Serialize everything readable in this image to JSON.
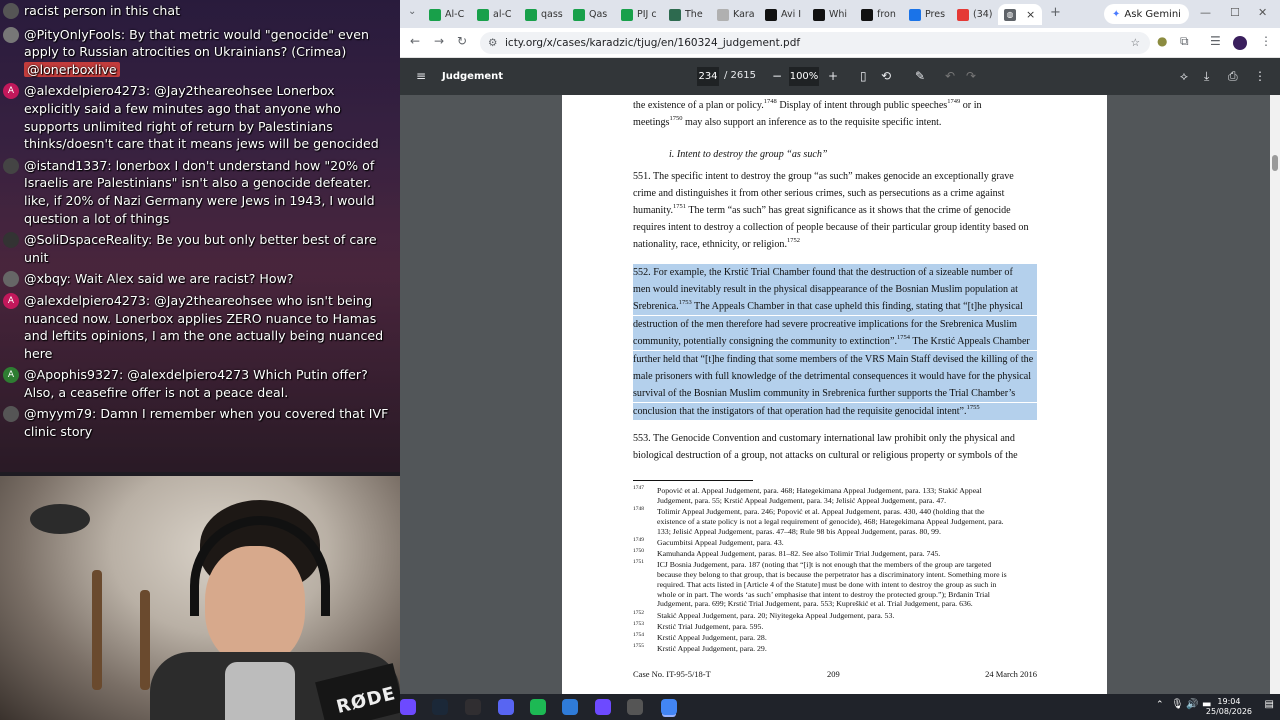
{
  "chat": {
    "messages": [
      {
        "user": "",
        "text": "racist person in this chat",
        "avatar": "",
        "avatar_color": "#555"
      },
      {
        "user": "@PityOnlyFools:",
        "text": " By that metric would \"genocide\" even apply to Russian atrocities on Ukrainians? (Crimea) ",
        "mention": "@lonerboxlive",
        "avatar": "",
        "avatar_color": "#777"
      },
      {
        "user": "@alexdelpiero4273:",
        "text": " @Jay2theareohsee Lonerbox explicitly said a few minutes ago that anyone who supports unlimited right of return by Palestinians thinks/doesn't care that it means jews will be genocided",
        "avatar": "A",
        "avatar_color": "#c2185b"
      },
      {
        "user": "@istand1337:",
        "text": " lonerbox I don't understand how \"20% of Israelis are Palestinians\" isn't also a genocide defeater. like, if 20% of Nazi Germany were Jews in 1943, I would question a lot of things",
        "avatar": "",
        "avatar_color": "#444"
      },
      {
        "user": "@SoliDspaceReality:",
        "text": " Be you but only better best of care unit",
        "avatar": "",
        "avatar_color": "#333"
      },
      {
        "user": "@xbqy:",
        "text": " Wait Alex said we are racist? How?",
        "avatar": "",
        "avatar_color": "#666"
      },
      {
        "user": "@alexdelpiero4273:",
        "text": " @Jay2theareohsee who isn't being nuanced now. Lonerbox applies ZERO nuance to Hamas and leftits opinions, I am the one actually being nuanced here",
        "avatar": "A",
        "avatar_color": "#c2185b"
      },
      {
        "user": "@Apophis9327:",
        "text": " @alexdelpiero4273 Which Putin offer? Also, a ceasefire offer is not a peace deal.",
        "avatar": "A",
        "avatar_color": "#2e7d32"
      },
      {
        "user": "@myym79:",
        "text": " Damn I remember when you covered that IVF clinic story",
        "avatar": "",
        "avatar_color": "#555"
      }
    ],
    "mic_brand": "RØDE"
  },
  "browser": {
    "tabs": [
      {
        "label": "Al-C",
        "color": "#18a04a"
      },
      {
        "label": "al-C",
        "color": "#18a04a"
      },
      {
        "label": "qass",
        "color": "#18a04a"
      },
      {
        "label": "Qas",
        "color": "#18a04a"
      },
      {
        "label": "PIJ c",
        "color": "#18a04a"
      },
      {
        "label": "The",
        "color": "#2d6a4f"
      },
      {
        "label": "Kara",
        "color": "#b0b0b0"
      },
      {
        "label": "Avi I",
        "color": "#111"
      },
      {
        "label": "Whi",
        "color": "#111"
      },
      {
        "label": "fron",
        "color": "#111"
      },
      {
        "label": "Pres",
        "color": "#1a73e8"
      },
      {
        "label": "(34)",
        "color": "#e53935"
      }
    ],
    "active_tab_close": "×",
    "new_tab": "+",
    "gemini_label": "Ask Gemini",
    "url": "icty.org/x/cases/karadzic/tjug/en/160324_judgement.pdf"
  },
  "pdf": {
    "title": "Judgement",
    "current_page": "234",
    "total_pages": "/ 2615",
    "zoom": "100%"
  },
  "document": {
    "lines": [
      {
        "text": "the existence of a plan or policy.",
        "sup": "1748",
        "tail": "  Display of intent through public speeches",
        "sup2": "1749",
        "tail2": " or in",
        "hl": false
      },
      {
        "text": "meetings",
        "sup": "1750",
        "tail": " may also support an inference as to the requisite specific intent.",
        "hl": false
      },
      {
        "text": "i.  Intent to destroy the group “as such”",
        "italic": true,
        "indent": true,
        "hl": false
      },
      {
        "text": "551.   The specific intent to destroy the group “as such” makes genocide an exceptionally grave",
        "hl": false
      },
      {
        "text": "crime and distinguishes it from other serious crimes, such as persecutions as a crime against",
        "hl": false
      },
      {
        "text": "humanity.",
        "sup": "1751",
        "tail": "  The term “as such” has great significance as it shows that the crime of genocide",
        "hl": false
      },
      {
        "text": "requires intent to destroy a collection of people because of their particular group identity based on",
        "hl": false
      },
      {
        "text": "nationality, race, ethnicity, or religion.",
        "sup": "1752",
        "hl": false
      },
      {
        "text": "552.   For example, the Krstić Trial Chamber found that the destruction of a sizeable number of",
        "hl": true
      },
      {
        "text": "men would inevitably result in the physical disappearance of the Bosnian Muslim population at",
        "hl": true
      },
      {
        "text": "Srebrenica.",
        "sup": "1753",
        "tail": " The Appeals Chamber in that case upheld this finding, stating that “[t]he physical",
        "hl": true
      },
      {
        "text": "destruction of the men therefore had severe procreative implications for the Srebrenica Muslim",
        "hl": true
      },
      {
        "text": "community, potentially consigning the community to extinction”.",
        "sup": "1754",
        "tail": "  The Krstić Appeals Chamber",
        "hl": true
      },
      {
        "text": "further held that “[t]he finding that some members of the VRS Main Staff devised the killing of the",
        "hl": true
      },
      {
        "text": "male prisoners with full knowledge of the detrimental consequences it would have for the physical",
        "hl": true
      },
      {
        "text": "survival of the Bosnian Muslim community in Srebrenica further supports the Trial Chamber’s",
        "hl": true
      },
      {
        "text": "conclusion that the instigators of that operation had the requisite genocidal intent”.",
        "sup": "1755",
        "hl": true
      },
      {
        "text": "553.   The Genocide Convention and customary international law prohibit only the physical and",
        "hl": false
      },
      {
        "text": "biological destruction of a group, not attacks on cultural or religious property or symbols of the",
        "hl": false
      }
    ],
    "footnotes": [
      {
        "n": "1747",
        "lines": [
          "Popović et al. Appeal Judgement, para. 468; Hategekimana Appeal Judgement, para. 133; Stakić Appeal",
          "Judgement, para. 55; Krstić Appeal Judgement, para. 34; Jelisić Appeal Judgement, para. 47."
        ]
      },
      {
        "n": "1748",
        "lines": [
          "Tolimir Appeal Judgement, para. 246; Popović et al. Appeal Judgement, paras. 430, 440 (holding that the",
          "existence of a state policy is not a legal requirement of genocide), 468; Hategekimana Appeal Judgement, para.",
          "133; Jelisić Appeal Judgement, paras. 47–48; Rule 98 bis Appeal Judgement, paras. 80, 99."
        ]
      },
      {
        "n": "1749",
        "lines": [
          "Gacumbitsi Appeal Judgement, para. 43."
        ]
      },
      {
        "n": "1750",
        "lines": [
          "Kamuhanda Appeal Judgement, paras. 81–82.  See also Tolimir Trial Judgement, para. 745."
        ]
      },
      {
        "n": "1751",
        "lines": [
          "ICJ Bosnia Judgement, para. 187 (noting that “[i]t is not enough that the members of the group are targeted",
          "because they belong to that group, that is because the perpetrator has a discriminatory intent. Something more is",
          "required.  That acts listed in [Article 4 of the Statute] must be done with intent to destroy the group as such in",
          "whole or in part.  The words ‘as such’ emphasise that intent to destroy the protected group.”); Brđanin Trial",
          "Judgement, para. 699; Krstić Trial Judgement, para. 553; Kupreškić et al. Trial Judgement, para. 636."
        ]
      },
      {
        "n": "1752",
        "lines": [
          "Stakić Appeal Judgement, para. 20; Niyitegeka Appeal Judgement, para. 53."
        ]
      },
      {
        "n": "1753",
        "lines": [
          "Krstić Trial Judgement, para. 595."
        ]
      },
      {
        "n": "1754",
        "lines": [
          "Krstić Appeal Judgement, para. 28."
        ]
      },
      {
        "n": "1755",
        "lines": [
          "Krstić Appeal Judgement, para. 29."
        ]
      }
    ],
    "footer": {
      "case": "Case No. IT-95-5/18-T",
      "page": "209",
      "date": "24 March 2016"
    }
  },
  "taskbar": {
    "apps": [
      {
        "name": "proton",
        "color": "#6d4aff"
      },
      {
        "name": "steam",
        "color": "#1b2838"
      },
      {
        "name": "obs",
        "color": "#302e31"
      },
      {
        "name": "discord",
        "color": "#5865f2"
      },
      {
        "name": "spotify",
        "color": "#1db954"
      },
      {
        "name": "vscode",
        "color": "#2f7bd8"
      },
      {
        "name": "proton-vpn",
        "color": "#6d4aff"
      },
      {
        "name": "settings",
        "color": "#555"
      },
      {
        "name": "chrome",
        "color": "#4285f4"
      }
    ],
    "time": "19:04",
    "date": "25/08/2026"
  }
}
